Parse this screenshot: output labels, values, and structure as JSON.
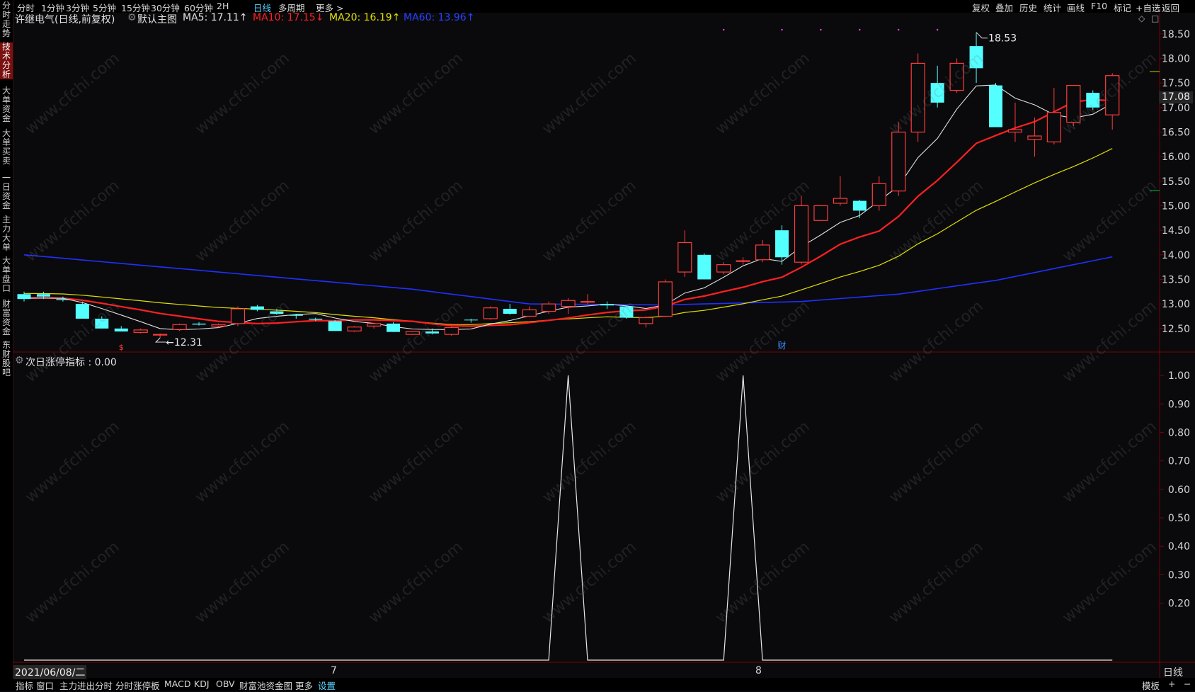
{
  "toolbar": {
    "left": [
      "分时",
      "1分钟",
      "3分钟",
      "5分钟",
      "15分钟",
      "30分钟",
      "60分钟",
      "2H",
      "日线",
      "多周期",
      "更多 >"
    ],
    "right": [
      "复权",
      "叠加",
      "历史",
      "统计",
      "画线",
      "F10",
      "标记",
      "+自选",
      "返回"
    ],
    "active": "日线"
  },
  "sidebar": [
    "分时走势",
    "技术分析",
    "大单资金",
    "大单买卖",
    "一日资金",
    "主力大单",
    "大单盘口",
    "财富资金",
    "东财股吧"
  ],
  "sidebar_active": "技术分析",
  "stock_title": "许继电气(日线,前复权)",
  "main_chart_label": "默认主图",
  "ma": {
    "ma5": "MA5: 17.11↑",
    "ma10": "MA10: 17.15↓",
    "ma20": "MA20: 16.19↑",
    "ma60": "MA60: 13.96↑"
  },
  "colors": {
    "ma5": "#e0e0e0",
    "ma10": "#ff2020",
    "ma20": "#e0e000",
    "ma60": "#2030ff",
    "up": "#ff3b3b",
    "down": "#54ffff",
    "bg": "#0a0a0d",
    "grid": "#5a0000"
  },
  "price_axis": [
    "18.50",
    "18.00",
    "17.50",
    "17.00",
    "16.50",
    "16.00",
    "15.50",
    "15.00",
    "14.50",
    "14.00",
    "13.50",
    "13.00",
    "12.50"
  ],
  "current_price": "17.08",
  "annotations": {
    "high": "18.53",
    "low": "12.31",
    "event": "财",
    "marker": "$"
  },
  "indicator": {
    "label": "次日涨停指标 : 0.00",
    "axis": [
      "1.00",
      "0.90",
      "0.80",
      "0.70",
      "0.60",
      "0.50",
      "0.40",
      "0.30",
      "0.20"
    ]
  },
  "date_axis": {
    "start": "2021/06/08/二",
    "month1": "7",
    "month2": "8",
    "period": "日线"
  },
  "bottom_tabs": [
    "指标",
    "窗口",
    "主力进出分时",
    "分时涨停板",
    "MACD",
    "KDJ",
    "OBV",
    "财富池资金图",
    "更多",
    "设置"
  ],
  "bottom_right": [
    "模板",
    "+",
    "−"
  ],
  "watermark": "www.cfchi.com",
  "chart_data": {
    "type": "candlestick",
    "candles": [
      {
        "o": 13.2,
        "h": 13.25,
        "l": 13.05,
        "c": 13.1
      },
      {
        "o": 13.2,
        "h": 13.25,
        "l": 13.1,
        "c": 13.15
      },
      {
        "o": 13.1,
        "h": 13.15,
        "l": 13.05,
        "c": 13.08
      },
      {
        "o": 13.0,
        "h": 13.05,
        "l": 12.7,
        "c": 12.7
      },
      {
        "o": 12.7,
        "h": 12.75,
        "l": 12.5,
        "c": 12.5
      },
      {
        "o": 12.5,
        "h": 12.55,
        "l": 12.44,
        "c": 12.44
      },
      {
        "o": 12.42,
        "h": 12.5,
        "l": 12.4,
        "c": 12.47
      },
      {
        "o": 12.38,
        "h": 12.4,
        "l": 12.31,
        "c": 12.38
      },
      {
        "o": 12.48,
        "h": 12.6,
        "l": 12.45,
        "c": 12.58
      },
      {
        "o": 12.6,
        "h": 12.63,
        "l": 12.56,
        "c": 12.58
      },
      {
        "o": 12.55,
        "h": 12.6,
        "l": 12.52,
        "c": 12.58
      },
      {
        "o": 12.6,
        "h": 12.95,
        "l": 12.55,
        "c": 12.9
      },
      {
        "o": 12.95,
        "h": 12.98,
        "l": 12.85,
        "c": 12.88
      },
      {
        "o": 12.85,
        "h": 12.9,
        "l": 12.78,
        "c": 12.8
      },
      {
        "o": 12.78,
        "h": 12.8,
        "l": 12.7,
        "c": 12.76
      },
      {
        "o": 12.7,
        "h": 12.72,
        "l": 12.65,
        "c": 12.68
      },
      {
        "o": 12.65,
        "h": 12.67,
        "l": 12.45,
        "c": 12.45
      },
      {
        "o": 12.45,
        "h": 12.55,
        "l": 12.43,
        "c": 12.53
      },
      {
        "o": 12.55,
        "h": 12.62,
        "l": 12.5,
        "c": 12.6
      },
      {
        "o": 12.6,
        "h": 12.63,
        "l": 12.43,
        "c": 12.43
      },
      {
        "o": 12.38,
        "h": 12.45,
        "l": 12.37,
        "c": 12.44
      },
      {
        "o": 12.44,
        "h": 12.5,
        "l": 12.38,
        "c": 12.4
      },
      {
        "o": 12.38,
        "h": 12.55,
        "l": 12.35,
        "c": 12.52
      },
      {
        "o": 12.68,
        "h": 12.7,
        "l": 12.62,
        "c": 12.67
      },
      {
        "o": 12.7,
        "h": 12.95,
        "l": 12.68,
        "c": 12.92
      },
      {
        "o": 12.9,
        "h": 13.0,
        "l": 12.78,
        "c": 12.8
      },
      {
        "o": 12.75,
        "h": 12.95,
        "l": 12.73,
        "c": 12.88
      },
      {
        "o": 12.85,
        "h": 13.05,
        "l": 12.8,
        "c": 13.0
      },
      {
        "o": 12.95,
        "h": 13.12,
        "l": 12.8,
        "c": 13.07
      },
      {
        "o": 13.05,
        "h": 13.2,
        "l": 13.0,
        "c": 13.05
      },
      {
        "o": 13.0,
        "h": 13.05,
        "l": 12.9,
        "c": 12.97
      },
      {
        "o": 12.95,
        "h": 12.97,
        "l": 12.7,
        "c": 12.72
      },
      {
        "o": 12.6,
        "h": 12.75,
        "l": 12.52,
        "c": 12.72
      },
      {
        "o": 12.75,
        "h": 13.5,
        "l": 12.73,
        "c": 13.45
      },
      {
        "o": 13.65,
        "h": 14.5,
        "l": 13.55,
        "c": 14.25
      },
      {
        "o": 14.0,
        "h": 14.03,
        "l": 13.5,
        "c": 13.5
      },
      {
        "o": 13.65,
        "h": 13.85,
        "l": 13.6,
        "c": 13.8
      },
      {
        "o": 13.88,
        "h": 13.95,
        "l": 13.8,
        "c": 13.88
      },
      {
        "o": 13.9,
        "h": 14.3,
        "l": 13.85,
        "c": 14.2
      },
      {
        "o": 14.5,
        "h": 14.6,
        "l": 13.8,
        "c": 13.95
      },
      {
        "o": 13.85,
        "h": 15.2,
        "l": 13.8,
        "c": 15.0
      },
      {
        "o": 14.7,
        "h": 15.0,
        "l": 14.7,
        "c": 15.0
      },
      {
        "o": 15.05,
        "h": 15.6,
        "l": 15.0,
        "c": 15.15
      },
      {
        "o": 15.1,
        "h": 15.12,
        "l": 14.75,
        "c": 14.9
      },
      {
        "o": 15.0,
        "h": 15.6,
        "l": 14.9,
        "c": 15.45
      },
      {
        "o": 15.3,
        "h": 16.7,
        "l": 15.2,
        "c": 16.5
      },
      {
        "o": 16.5,
        "h": 18.1,
        "l": 16.3,
        "c": 17.9
      },
      {
        "o": 17.5,
        "h": 17.85,
        "l": 17.0,
        "c": 17.1
      },
      {
        "o": 17.35,
        "h": 18.0,
        "l": 17.3,
        "c": 17.9
      },
      {
        "o": 18.25,
        "h": 18.53,
        "l": 17.5,
        "c": 17.8
      },
      {
        "o": 17.45,
        "h": 17.5,
        "l": 16.6,
        "c": 16.6
      },
      {
        "o": 16.5,
        "h": 17.1,
        "l": 16.3,
        "c": 16.55
      },
      {
        "o": 16.35,
        "h": 16.8,
        "l": 16.0,
        "c": 16.42
      },
      {
        "o": 16.3,
        "h": 17.4,
        "l": 16.25,
        "c": 16.9
      },
      {
        "o": 16.7,
        "h": 17.45,
        "l": 16.62,
        "c": 17.45
      },
      {
        "o": 17.3,
        "h": 17.35,
        "l": 16.95,
        "c": 17.0
      },
      {
        "o": 16.85,
        "h": 17.7,
        "l": 16.55,
        "c": 17.65
      }
    ],
    "indicator_signals": [
      {
        "index": 28,
        "value": 1.0
      },
      {
        "index": 37,
        "value": 1.0
      }
    ],
    "price_range": [
      12.05,
      18.67
    ],
    "indicator_range": [
      0.0,
      1.03
    ]
  }
}
